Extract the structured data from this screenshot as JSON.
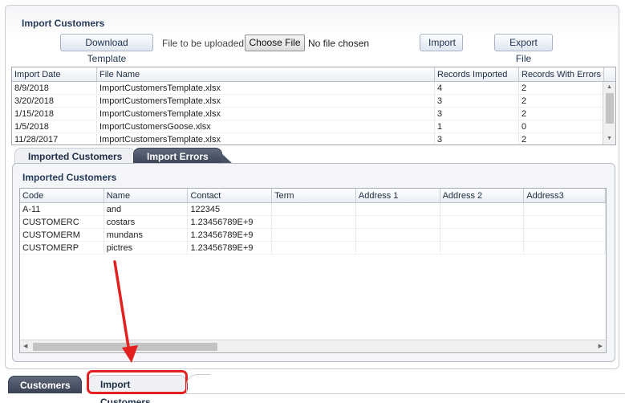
{
  "panel": {
    "title": "Import Customers"
  },
  "toolbar": {
    "download_label": "Download Template",
    "file_label": "File to be uploaded",
    "choose_label": "Choose File",
    "no_file_text": "No file chosen",
    "import_label": "Import",
    "export_label": "Export File"
  },
  "imports_table": {
    "columns": [
      "Import Date",
      "File Name",
      "Records Imported",
      "Records With Errors"
    ],
    "rows": [
      [
        "8/9/2018",
        "ImportCustomersTemplate.xlsx",
        "4",
        "2"
      ],
      [
        "3/20/2018",
        "ImportCustomersTemplate.xlsx",
        "3",
        "2"
      ],
      [
        "1/15/2018",
        "ImportCustomersTemplate.xlsx",
        "3",
        "2"
      ],
      [
        "1/5/2018",
        "ImportCustomersGoose.xlsx",
        "1",
        "0"
      ],
      [
        "11/28/2017",
        "ImportCustomersTemplate.xlsx",
        "3",
        "2"
      ]
    ]
  },
  "inner_tabs": [
    "Imported Customers",
    "Import Errors"
  ],
  "imported_panel": {
    "title": "Imported Customers"
  },
  "customers_table": {
    "columns": [
      "Code",
      "Name",
      "Contact",
      "Term",
      "Address 1",
      "Address 2",
      "Address3"
    ],
    "rows": [
      [
        "A-11",
        "and",
        "122345",
        "",
        "",
        "",
        ""
      ],
      [
        "CUSTOMERC",
        "costars",
        "1.23456789E+9",
        "",
        "",
        "",
        ""
      ],
      [
        "CUSTOMERM",
        "mundans",
        "1.23456789E+9",
        "",
        "",
        "",
        ""
      ],
      [
        "CUSTOMERP",
        "pictres",
        "1.23456789E+9",
        "",
        "",
        "",
        ""
      ]
    ]
  },
  "bottom_tabs": [
    "Customers",
    "Import Customers"
  ],
  "colors": {
    "highlight": "#e42020",
    "title": "#263a59",
    "dark_tab": "#3d4657"
  }
}
